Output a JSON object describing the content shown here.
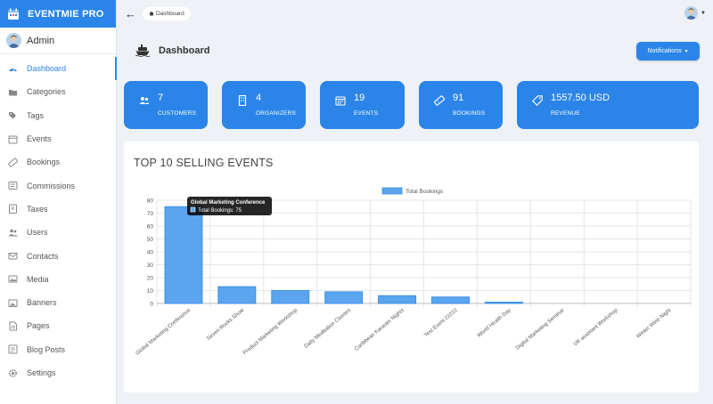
{
  "brand": {
    "name": "EVENTMIE PRO"
  },
  "admin": {
    "name": "Admin"
  },
  "sidebar": {
    "items": [
      {
        "label": "Dashboard",
        "icon": "dashboard-icon",
        "active": true
      },
      {
        "label": "Categories",
        "icon": "folder-icon"
      },
      {
        "label": "Tags",
        "icon": "tags-icon"
      },
      {
        "label": "Events",
        "icon": "calendar-icon"
      },
      {
        "label": "Bookings",
        "icon": "ticket-icon"
      },
      {
        "label": "Commissions",
        "icon": "commission-icon"
      },
      {
        "label": "Taxes",
        "icon": "tax-icon"
      },
      {
        "label": "Users",
        "icon": "users-icon"
      },
      {
        "label": "Contacts",
        "icon": "mail-icon"
      },
      {
        "label": "Media",
        "icon": "media-icon"
      },
      {
        "label": "Banners",
        "icon": "banner-icon"
      },
      {
        "label": "Pages",
        "icon": "page-icon"
      },
      {
        "label": "Blog Posts",
        "icon": "blog-icon"
      },
      {
        "label": "Settings",
        "icon": "settings-icon"
      }
    ]
  },
  "topbar": {
    "breadcrumb": "Dashboard"
  },
  "header": {
    "title": "Dashboard",
    "notifications_label": "Notifications"
  },
  "stats": [
    {
      "value": "7",
      "label": "CUSTOMERS",
      "icon": "users-icon"
    },
    {
      "value": "4",
      "label": "ORGANIZERS",
      "icon": "building-icon"
    },
    {
      "value": "19",
      "label": "EVENTS",
      "icon": "calendar-icon"
    },
    {
      "value": "91",
      "label": "BOOKINGS",
      "icon": "ticket-icon"
    },
    {
      "value": "1557.50 USD",
      "label": "REVENUE",
      "icon": "price-tag-icon"
    }
  ],
  "panel": {
    "title": "TOP 10 SELLING EVENTS"
  },
  "colors": {
    "accent": "#2b85e8",
    "bar_fill": "#5ba4ee",
    "bar_stroke": "#3d8fe6"
  },
  "chart_data": {
    "type": "bar",
    "categories": [
      "Global Marketing Conference",
      "Seven Rocks Show",
      "Product Marketing Workshop",
      "Daily Meditation Classes",
      "Caribbean Karaoke Nights",
      "Test Event 22222",
      "World Health Day",
      "Digital Marketing Seminar",
      "VR assistant Workshop",
      "Winter Wine Night"
    ],
    "series": [
      {
        "name": "Total Bookings",
        "values": [
          75,
          13,
          10,
          9,
          6,
          5,
          1,
          0,
          0,
          0
        ]
      }
    ],
    "ylim": [
      0,
      80
    ],
    "yticks": [
      0,
      10,
      20,
      30,
      40,
      50,
      60,
      70,
      80
    ],
    "grid": true,
    "legend": "top-center",
    "tooltip": {
      "title": "Global Marketing Conference",
      "text": "Total Bookings: 75"
    }
  }
}
